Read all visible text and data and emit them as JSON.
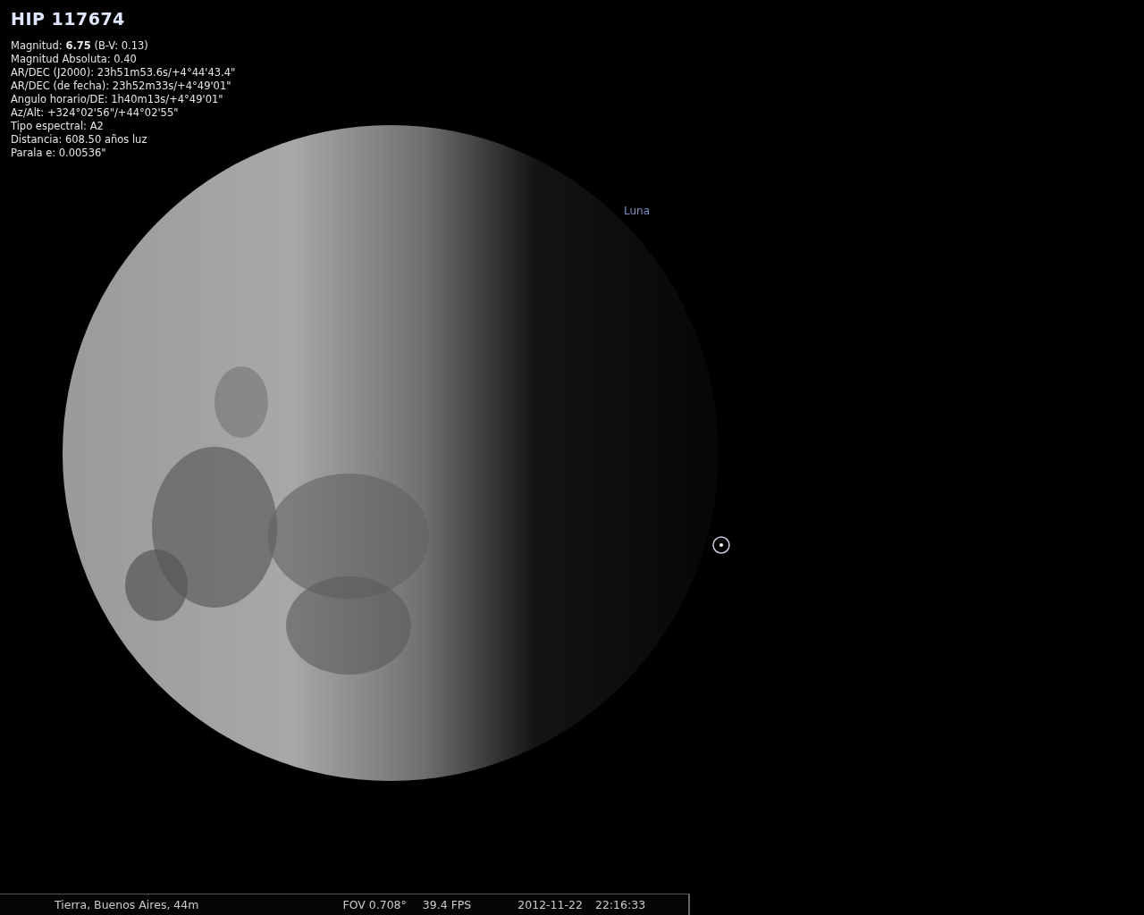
{
  "object_title": "HIP 117674",
  "info_lines": [
    "Magnitud: **6.75** (B-V: 0.13)",
    "Magnitud Absoluta: 0.40",
    "AR/DEC (J2000): 23h51m53.6s/+4°44'43.4\"",
    "AR/DEC (de fecha): 23h52m33s/+4°49'01\"",
    "Angulo horario/DE: 1h40m13s/+4°49'01\"",
    "Az/Alt: +324°02'56\"/+44°02'55\"",
    "Tipo espectral: A2",
    "Distancia: 608.50 años luz",
    "Parala e: 0.00536\""
  ],
  "sky_labels": [
    {
      "text": "Luna"
    }
  ],
  "status_bar": {
    "location": "Tierra, Buenos Aires, 44m",
    "fov": "FOV 0.708°",
    "fps": "39.4 FPS",
    "date": "2012-11-22",
    "time": "22:16:33"
  }
}
